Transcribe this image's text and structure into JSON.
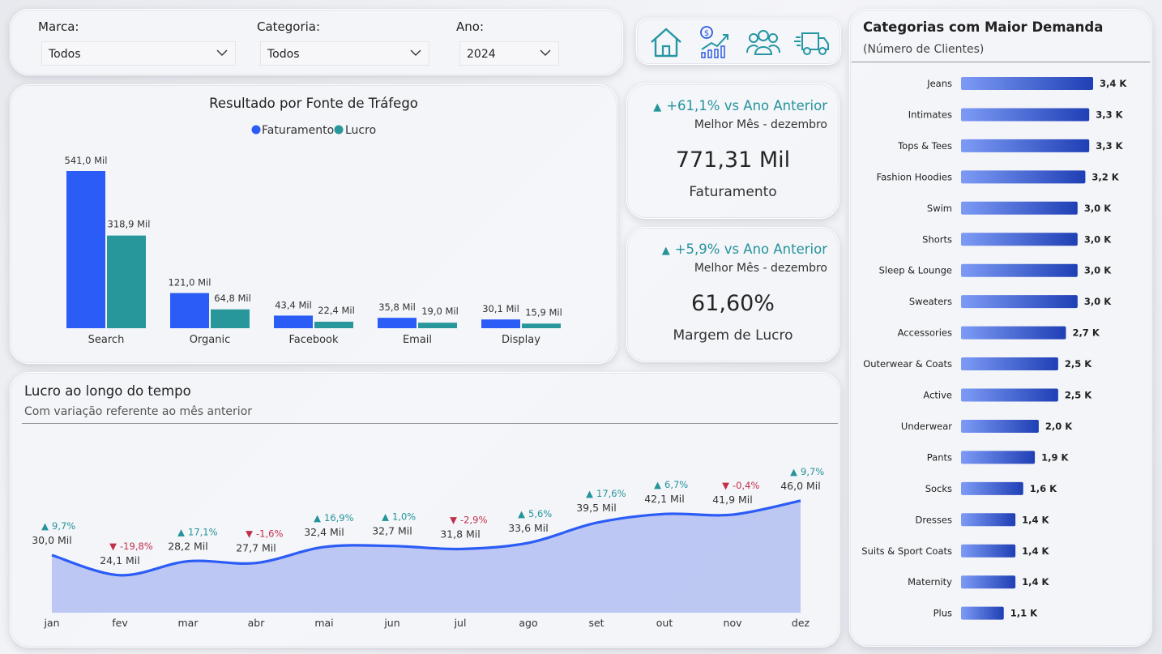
{
  "filters": [
    {
      "label": "Marca:",
      "value": "Todos"
    },
    {
      "label": "Categoria:",
      "value": "Todos"
    },
    {
      "label": "Ano:",
      "value": "2024"
    }
  ],
  "nav": {
    "icons": [
      "home-icon",
      "finance-chart-icon",
      "customers-icon",
      "delivery-truck-icon"
    ]
  },
  "colors": {
    "faturamento": "#2b5cf6",
    "lucro": "#27979b",
    "positive": "#24939a",
    "negative": "#c0304a",
    "line": "#2b5cf6"
  },
  "traffic": {
    "title": "Resultado por Fonte de Tráfego",
    "legend": [
      "Faturamento",
      "Lucro"
    ],
    "labels_fat": [
      "541,0 Mil",
      "121,0 Mil",
      "43,4 Mil",
      "35,8 Mil",
      "30,1 Mil"
    ],
    "labels_lucro": [
      "318,9 Mil",
      "64,8 Mil",
      "22,4 Mil",
      "19,0 Mil",
      "15,9 Mil"
    ]
  },
  "kpi1": {
    "delta": "+61,1% vs Ano Anterior",
    "sub": "Melhor Mês - dezembro",
    "value": "771,31 Mil",
    "label": "Faturamento"
  },
  "kpi2": {
    "delta": "+5,9% vs Ano Anterior",
    "sub": "Melhor Mês - dezembro",
    "value": "61,60%",
    "label": "Margem de Lucro"
  },
  "profit": {
    "title": "Lucro ao longo do tempo",
    "subtitle": "Com variação referente ao mês anterior",
    "value_labels": [
      "30,0 Mil",
      "24,1 Mil",
      "28,2 Mil",
      "27,7 Mil",
      "32,4 Mil",
      "32,7 Mil",
      "31,8 Mil",
      "33,6 Mil",
      "39,5 Mil",
      "42,1 Mil",
      "41,9 Mil",
      "46,0 Mil"
    ],
    "change_labels": [
      "9,7%",
      "-19,8%",
      "17,1%",
      "-1,6%",
      "16,9%",
      "1,0%",
      "-2,9%",
      "5,6%",
      "17,6%",
      "6,7%",
      "-0,4%",
      "9,7%"
    ]
  },
  "demand": {
    "title": "Categorias com Maior Demanda",
    "subtitle": "(Número de Clientes)",
    "value_labels": [
      "3,4 K",
      "3,3 K",
      "3,3 K",
      "3,2 K",
      "3,0 K",
      "3,0 K",
      "3,0 K",
      "3,0 K",
      "2,7 K",
      "2,5 K",
      "2,5 K",
      "2,0 K",
      "1,9 K",
      "1,6 K",
      "1,4 K",
      "1,4 K",
      "1,4 K",
      "1,1 K"
    ]
  },
  "chart_data": [
    {
      "type": "bar",
      "title": "Resultado por Fonte de Tráfego",
      "categories": [
        "Search",
        "Organic",
        "Facebook",
        "Email",
        "Display"
      ],
      "series": [
        {
          "name": "Faturamento",
          "values": [
            541.0,
            121.0,
            43.4,
            35.8,
            30.1
          ]
        },
        {
          "name": "Lucro",
          "values": [
            318.9,
            64.8,
            22.4,
            19.0,
            15.9
          ]
        }
      ],
      "legend": "top-center",
      "grid": false
    },
    {
      "type": "area",
      "title": "Lucro ao longo do tempo",
      "subtitle": "Com variação referente ao mês anterior",
      "categories": [
        "jan",
        "fev",
        "mar",
        "abr",
        "mai",
        "jun",
        "jul",
        "ago",
        "set",
        "out",
        "nov",
        "dez"
      ],
      "values": [
        30.0,
        24.1,
        28.2,
        27.7,
        32.4,
        32.7,
        31.8,
        33.6,
        39.5,
        42.1,
        41.9,
        46.0
      ],
      "change_pct": [
        9.7,
        -19.8,
        17.1,
        -1.6,
        16.9,
        1.0,
        -2.9,
        5.6,
        17.6,
        6.7,
        -0.4,
        9.7
      ],
      "grid": false
    },
    {
      "type": "bar",
      "orientation": "horizontal",
      "title": "Categorias com Maior Demanda",
      "subtitle": "(Número de Clientes)",
      "categories": [
        "Jeans",
        "Intimates",
        "Tops & Tees",
        "Fashion Hoodies",
        "Swim",
        "Shorts",
        "Sleep & Lounge",
        "Sweaters",
        "Accessories",
        "Outerwear & Coats",
        "Active",
        "Underwear",
        "Pants",
        "Socks",
        "Dresses",
        "Suits & Sport Coats",
        "Maternity",
        "Plus"
      ],
      "values": [
        3.4,
        3.3,
        3.3,
        3.2,
        3.0,
        3.0,
        3.0,
        3.0,
        2.7,
        2.5,
        2.5,
        2.0,
        1.9,
        1.6,
        1.4,
        1.4,
        1.4,
        1.1
      ],
      "grid": false
    }
  ]
}
